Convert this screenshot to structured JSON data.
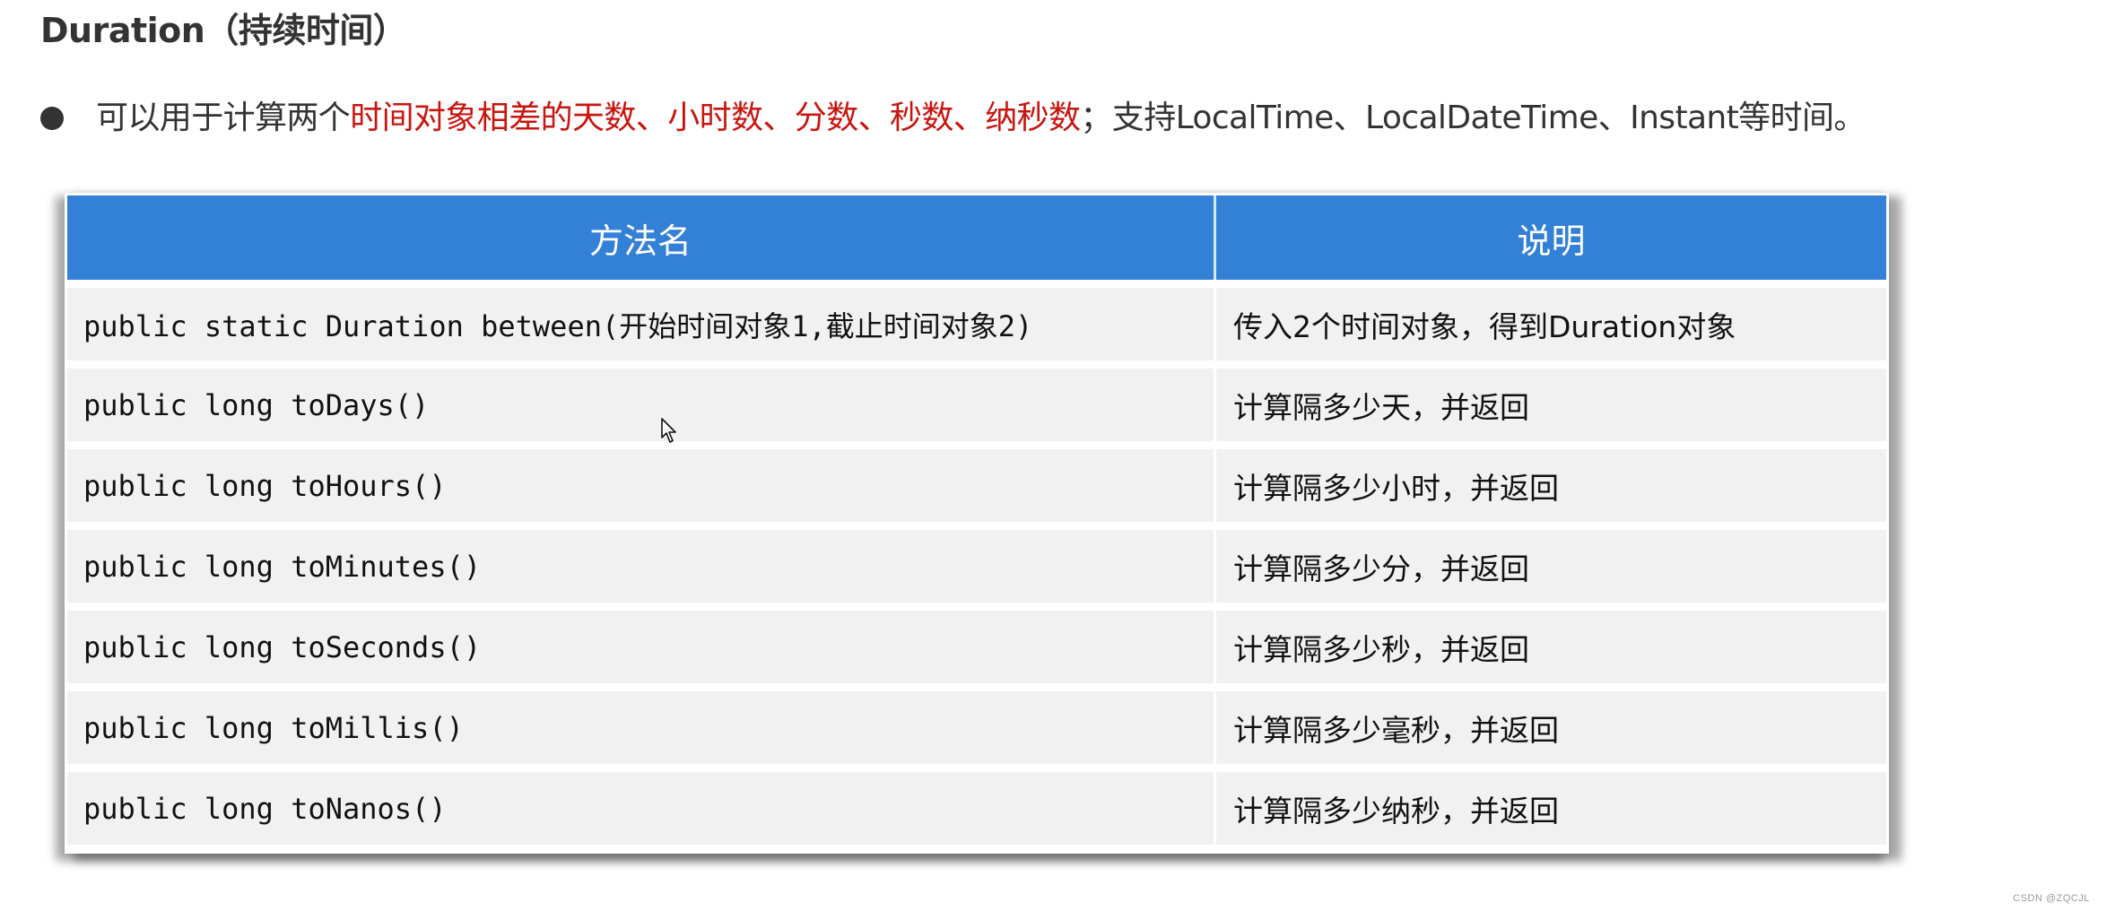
{
  "title": {
    "main": "Duration",
    "paren": "（持续时间）"
  },
  "bullet": {
    "icon": "bullet-dot",
    "text_before": "可以用于计算两个",
    "text_highlight": "时间对象相差的天数、小时数、分数、秒数、纳秒数",
    "text_after": "；支持LocalTime、LocalDateTime、Instant等时间。",
    "highlight_color": "#c8160f"
  },
  "table": {
    "header_color": "#3380d7",
    "columns": [
      "方法名",
      "说明"
    ],
    "rows": [
      {
        "method": "public static Duration between(开始时间对象1,截止时间对象2)",
        "desc": "传入2个时间对象，得到Duration对象"
      },
      {
        "method": "public long toDays()",
        "desc": "计算隔多少天，并返回"
      },
      {
        "method": "public long toHours()",
        "desc": "计算隔多少小时，并返回"
      },
      {
        "method": "public long toMinutes()",
        "desc": "计算隔多少分，并返回"
      },
      {
        "method": "public long toSeconds()",
        "desc": "计算隔多少秒，并返回"
      },
      {
        "method": "public long toMillis()",
        "desc": "计算隔多少毫秒，并返回"
      },
      {
        "method": "public long toNanos()",
        "desc": "计算隔多少纳秒，并返回"
      }
    ]
  },
  "cursor": {
    "icon": "mouse-pointer-arrow"
  },
  "watermark": "CSDN @ZQCJL"
}
